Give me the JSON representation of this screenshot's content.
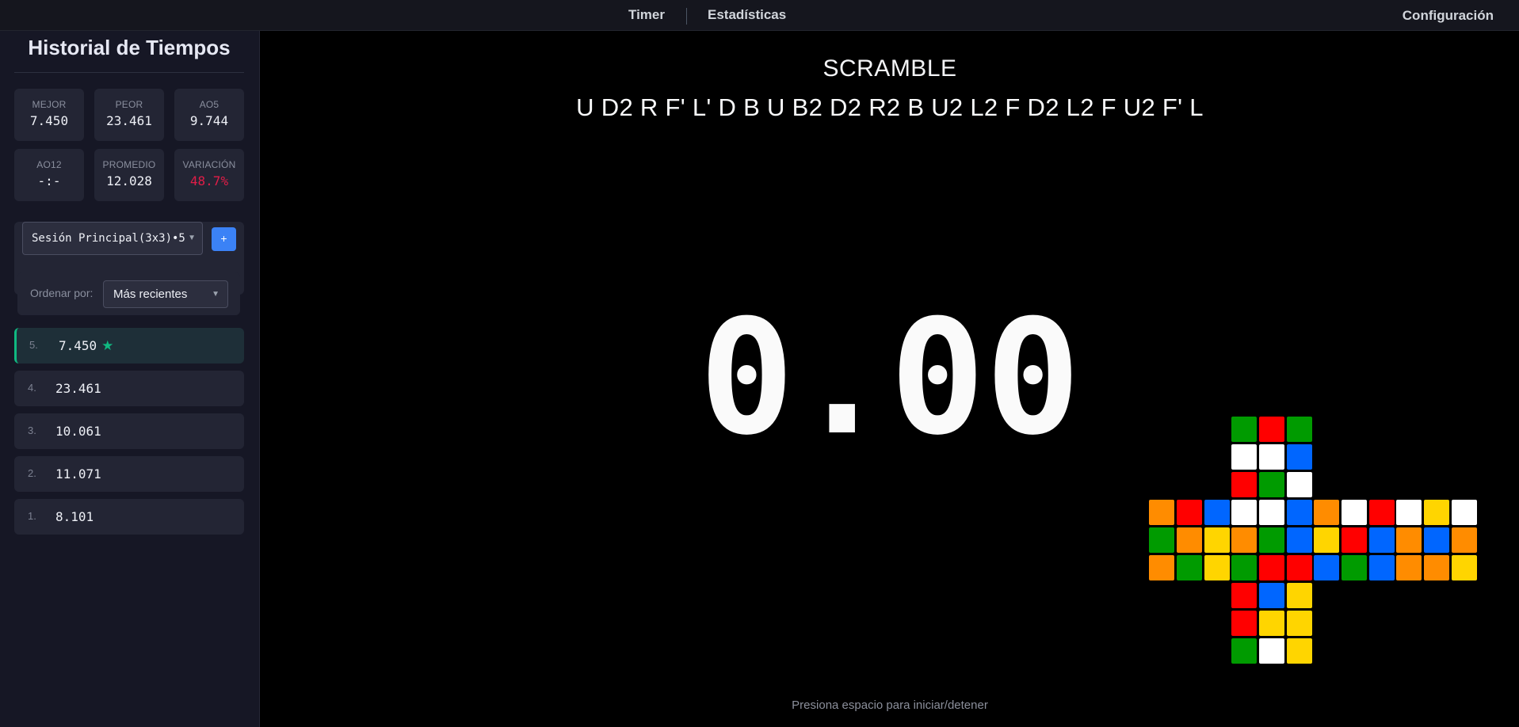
{
  "nav": {
    "timer": "Timer",
    "stats": "Estadísticas",
    "config": "Configuración"
  },
  "sidebar": {
    "title": "Historial de Tiempos",
    "stats": [
      {
        "label": "MEJOR",
        "value": "7.450"
      },
      {
        "label": "PEOR",
        "value": "23.461"
      },
      {
        "label": "AO5",
        "value": "9.744"
      },
      {
        "label": "AO12",
        "value": "-:-"
      },
      {
        "label": "PROMEDIO",
        "value": "12.028"
      },
      {
        "label": "VARIACIÓN",
        "value": "48.7%"
      }
    ],
    "session": {
      "selected": "Sesión Principal(3x3)•5",
      "add_label": "+"
    },
    "sort": {
      "label": "Ordenar por:",
      "selected": "Más recientes"
    },
    "times": [
      {
        "index": "5.",
        "value": "7.450",
        "best": true
      },
      {
        "index": "4.",
        "value": "23.461"
      },
      {
        "index": "3.",
        "value": "10.061"
      },
      {
        "index": "2.",
        "value": "11.071"
      },
      {
        "index": "1.",
        "value": "8.101"
      }
    ]
  },
  "main": {
    "scramble_title": "SCRAMBLE",
    "scramble": "U D2 R F' L' D B U B2 D2 R2 B U2 L2 F D2 L2 F U2 F' L",
    "timer": "0.00",
    "hint": "Presiona espacio para iniciar/detener"
  },
  "colors": {
    "accent": "#3b82f6",
    "best": "#10b981",
    "bad": "#e11d48",
    "W": "#ffffff",
    "Y": "#ffd500",
    "R": "#ff0000",
    "O": "#ff8c00",
    "B": "#0066ff",
    "G": "#009b00"
  },
  "cube": {
    "U": [
      "G",
      "R",
      "G",
      "W",
      "W",
      "B",
      "R",
      "G",
      "W"
    ],
    "L": [
      "O",
      "R",
      "B",
      "G",
      "O",
      "Y",
      "O",
      "G",
      "Y"
    ],
    "F": [
      "W",
      "W",
      "B",
      "O",
      "G",
      "B",
      "G",
      "R",
      "R"
    ],
    "R": [
      "O",
      "W",
      "R",
      "Y",
      "R",
      "B",
      "B",
      "G",
      "B"
    ],
    "B": [
      "W",
      "Y",
      "W",
      "O",
      "B",
      "O",
      "O",
      "O",
      "Y"
    ],
    "D": [
      "R",
      "B",
      "Y",
      "R",
      "Y",
      "Y",
      "G",
      "W",
      "Y"
    ]
  }
}
